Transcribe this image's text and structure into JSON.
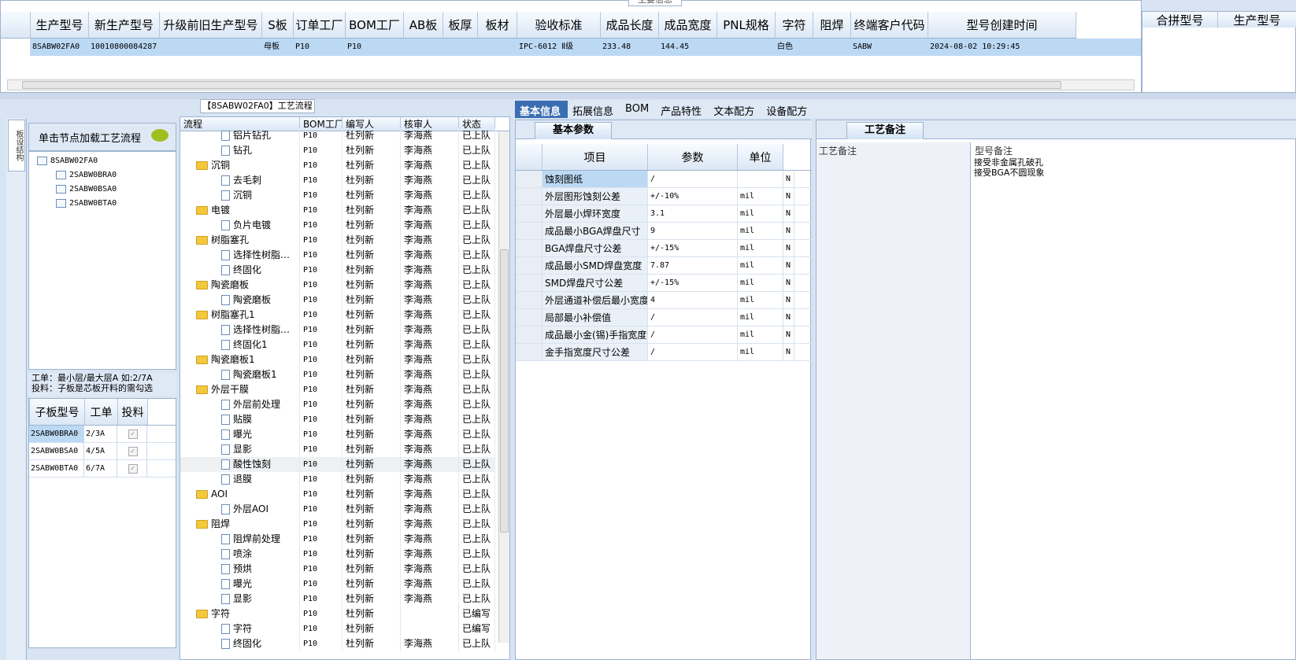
{
  "top_panel": {
    "title": "主要信息",
    "headers": [
      "生产型号",
      "新生产型号",
      "升级前旧生产型号",
      "S板",
      "订单工厂",
      "BOM工厂",
      "AB板",
      "板厚",
      "板材",
      "验收标准",
      "成品长度",
      "成品宽度",
      "PNL规格",
      "字符",
      "阻焊",
      "终端客户代码",
      "型号创建时间"
    ],
    "row": [
      "8SABW02FA0",
      "10010800084287",
      "",
      "母板",
      "P10",
      "P10",
      "",
      "",
      "",
      "IPC-6012 Ⅱ级",
      "233.48",
      "144.45",
      "",
      "白色",
      "",
      "SABW",
      "2024-08-02 10:29:45"
    ]
  },
  "merge_panel": {
    "headers": [
      "合拼型号",
      "生产型号"
    ]
  },
  "left_panel": {
    "tab_label": "板设结构",
    "title": "单击节点加载工艺流程",
    "tree": [
      {
        "label": "8SABW02FA0",
        "level": 0
      },
      {
        "label": "2SABW0BRA0",
        "level": 1
      },
      {
        "label": "2SABW0BSA0",
        "level": 1
      },
      {
        "label": "2SABW0BTA0",
        "level": 1
      }
    ],
    "note_line1": "工单：最小层/最大层A 如:2/7A",
    "note_line2": "投料：子板是芯板开料的需勾选",
    "sub_headers": [
      "子板型号",
      "工单",
      "投料"
    ],
    "sub_rows": [
      {
        "model": "2SABW0BRA0",
        "order": "2/3A",
        "feed": "✓"
      },
      {
        "model": "2SABW0BSA0",
        "order": "4/5A",
        "feed": "✓"
      },
      {
        "model": "2SABW0BTA0",
        "order": "6/7A",
        "feed": "✓"
      }
    ]
  },
  "flow_panel": {
    "title": "【8SABW02FA0】工艺流程",
    "headers": [
      "流程",
      "BOM工厂",
      "编写人",
      "核审人",
      "状态"
    ],
    "rows": [
      {
        "name": "铝片钻孔",
        "type": "doc",
        "bom": "P10",
        "writer": "杜列新",
        "reviewer": "李海燕",
        "status": "已上队"
      },
      {
        "name": "钻孔",
        "type": "doc",
        "bom": "P10",
        "writer": "杜列新",
        "reviewer": "李海燕",
        "status": "已上队"
      },
      {
        "name": "沉铜",
        "type": "folder",
        "bom": "P10",
        "writer": "杜列新",
        "reviewer": "李海燕",
        "status": "已上队"
      },
      {
        "name": "去毛刺",
        "type": "doc",
        "bom": "P10",
        "writer": "杜列新",
        "reviewer": "李海燕",
        "status": "已上队"
      },
      {
        "name": "沉铜",
        "type": "doc",
        "bom": "P10",
        "writer": "杜列新",
        "reviewer": "李海燕",
        "status": "已上队"
      },
      {
        "name": "电镀",
        "type": "folder",
        "bom": "P10",
        "writer": "杜列新",
        "reviewer": "李海燕",
        "status": "已上队"
      },
      {
        "name": "负片电镀",
        "type": "doc",
        "bom": "P10",
        "writer": "杜列新",
        "reviewer": "李海燕",
        "status": "已上队"
      },
      {
        "name": "树脂塞孔",
        "type": "folder",
        "bom": "P10",
        "writer": "杜列新",
        "reviewer": "李海燕",
        "status": "已上队"
      },
      {
        "name": "选择性树脂…",
        "type": "doc",
        "bom": "P10",
        "writer": "杜列新",
        "reviewer": "李海燕",
        "status": "已上队"
      },
      {
        "name": "终固化",
        "type": "doc",
        "bom": "P10",
        "writer": "杜列新",
        "reviewer": "李海燕",
        "status": "已上队"
      },
      {
        "name": "陶瓷磨板",
        "type": "folder",
        "bom": "P10",
        "writer": "杜列新",
        "reviewer": "李海燕",
        "status": "已上队"
      },
      {
        "name": "陶瓷磨板",
        "type": "doc",
        "bom": "P10",
        "writer": "杜列新",
        "reviewer": "李海燕",
        "status": "已上队"
      },
      {
        "name": "树脂塞孔1",
        "type": "folder",
        "bom": "P10",
        "writer": "杜列新",
        "reviewer": "李海燕",
        "status": "已上队"
      },
      {
        "name": "选择性树脂…",
        "type": "doc",
        "bom": "P10",
        "writer": "杜列新",
        "reviewer": "李海燕",
        "status": "已上队"
      },
      {
        "name": "终固化1",
        "type": "doc",
        "bom": "P10",
        "writer": "杜列新",
        "reviewer": "李海燕",
        "status": "已上队"
      },
      {
        "name": "陶瓷磨板1",
        "type": "folder",
        "bom": "P10",
        "writer": "杜列新",
        "reviewer": "李海燕",
        "status": "已上队"
      },
      {
        "name": "陶瓷磨板1",
        "type": "doc",
        "bom": "P10",
        "writer": "杜列新",
        "reviewer": "李海燕",
        "status": "已上队"
      },
      {
        "name": "外层干膜",
        "type": "folder",
        "bom": "P10",
        "writer": "杜列新",
        "reviewer": "李海燕",
        "status": "已上队"
      },
      {
        "name": "外层前处理",
        "type": "doc",
        "bom": "P10",
        "writer": "杜列新",
        "reviewer": "李海燕",
        "status": "已上队"
      },
      {
        "name": "贴膜",
        "type": "doc",
        "bom": "P10",
        "writer": "杜列新",
        "reviewer": "李海燕",
        "status": "已上队"
      },
      {
        "name": "曝光",
        "type": "doc",
        "bom": "P10",
        "writer": "杜列新",
        "reviewer": "李海燕",
        "status": "已上队"
      },
      {
        "name": "显影",
        "type": "doc",
        "bom": "P10",
        "writer": "杜列新",
        "reviewer": "李海燕",
        "status": "已上队"
      },
      {
        "name": "酸性蚀刻",
        "type": "doc",
        "bom": "P10",
        "writer": "杜列新",
        "reviewer": "李海燕",
        "status": "已上队",
        "selected": true
      },
      {
        "name": "退膜",
        "type": "doc",
        "bom": "P10",
        "writer": "杜列新",
        "reviewer": "李海燕",
        "status": "已上队"
      },
      {
        "name": "AOI",
        "type": "folder",
        "bom": "P10",
        "writer": "杜列新",
        "reviewer": "李海燕",
        "status": "已上队"
      },
      {
        "name": "外层AOI",
        "type": "doc",
        "bom": "P10",
        "writer": "杜列新",
        "reviewer": "李海燕",
        "status": "已上队"
      },
      {
        "name": "阻焊",
        "type": "folder",
        "bom": "P10",
        "writer": "杜列新",
        "reviewer": "李海燕",
        "status": "已上队"
      },
      {
        "name": "阻焊前处理",
        "type": "doc",
        "bom": "P10",
        "writer": "杜列新",
        "reviewer": "李海燕",
        "status": "已上队"
      },
      {
        "name": "喷涂",
        "type": "doc",
        "bom": "P10",
        "writer": "杜列新",
        "reviewer": "李海燕",
        "status": "已上队"
      },
      {
        "name": "预烘",
        "type": "doc",
        "bom": "P10",
        "writer": "杜列新",
        "reviewer": "李海燕",
        "status": "已上队"
      },
      {
        "name": "曝光",
        "type": "doc",
        "bom": "P10",
        "writer": "杜列新",
        "reviewer": "李海燕",
        "status": "已上队"
      },
      {
        "name": "显影",
        "type": "doc",
        "bom": "P10",
        "writer": "杜列新",
        "reviewer": "李海燕",
        "status": "已上队"
      },
      {
        "name": "字符",
        "type": "folder",
        "bom": "P10",
        "writer": "杜列新",
        "reviewer": "",
        "status": "已编写"
      },
      {
        "name": "字符",
        "type": "doc",
        "bom": "P10",
        "writer": "杜列新",
        "reviewer": "",
        "status": "已编写"
      },
      {
        "name": "终固化",
        "type": "doc",
        "bom": "P10",
        "writer": "杜列新",
        "reviewer": "李海燕",
        "status": "已上队"
      }
    ]
  },
  "tabs": [
    "基本信息",
    "拓展信息",
    "BOM",
    "产品特性",
    "文本配方",
    "设备配方"
  ],
  "param_panel": {
    "title": "基本参数",
    "headers": [
      "项目",
      "参数",
      "单位"
    ],
    "rows": [
      {
        "item": "蚀刻图纸",
        "param": "/",
        "unit": "",
        "flag": "N"
      },
      {
        "item": "外层图形蚀刻公差",
        "param": "+/-10%",
        "unit": "mil",
        "flag": "N"
      },
      {
        "item": "外层最小焊环宽度",
        "param": "3.1",
        "unit": "mil",
        "flag": "N"
      },
      {
        "item": "成品最小BGA焊盘尺寸",
        "param": "9",
        "unit": "mil",
        "flag": "N"
      },
      {
        "item": "BGA焊盘尺寸公差",
        "param": "+/-15%",
        "unit": "mil",
        "flag": "N"
      },
      {
        "item": "成品最小SMD焊盘宽度",
        "param": "7.87",
        "unit": "mil",
        "flag": "N"
      },
      {
        "item": "SMD焊盘尺寸公差",
        "param": "+/-15%",
        "unit": "mil",
        "flag": "N"
      },
      {
        "item": "外层通道补偿后最小宽度",
        "param": "4",
        "unit": "mil",
        "flag": "N"
      },
      {
        "item": "局部最小补偿值",
        "param": "/",
        "unit": "mil",
        "flag": "N"
      },
      {
        "item": "成品最小金(锡)手指宽度",
        "param": "/",
        "unit": "mil",
        "flag": "N"
      },
      {
        "item": "金手指宽度尺寸公差",
        "param": "/",
        "unit": "mil",
        "flag": "N"
      }
    ]
  },
  "craft_panel": {
    "title": "工艺备注",
    "left_label": "工艺备注",
    "right_label": "型号备注",
    "remarks": [
      "接受非金属孔破孔",
      "接受BGA不圆现象"
    ]
  }
}
